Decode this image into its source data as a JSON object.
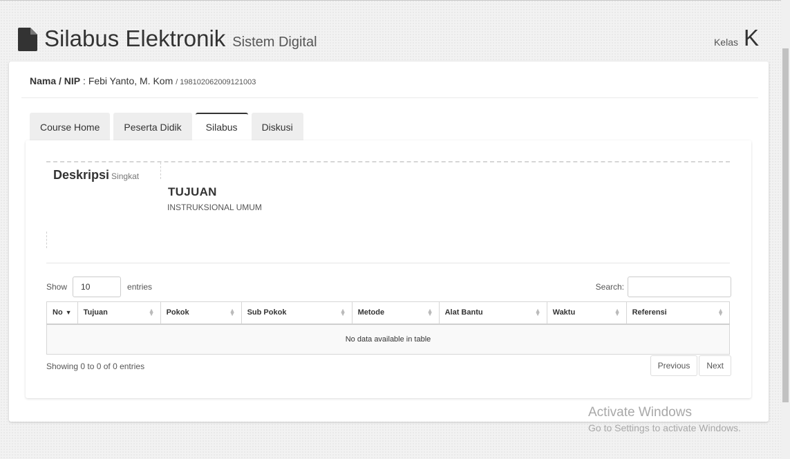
{
  "header": {
    "title": "Silabus Elektronik",
    "subtitle": "Sistem Digital",
    "kelas_label": "Kelas",
    "kelas_value": "K"
  },
  "teacher": {
    "label": "Nama / NIP",
    "name": "Febi Yanto, M. Kom",
    "nip": "198102062009121003"
  },
  "tabs": [
    {
      "label": "Course Home",
      "active": false
    },
    {
      "label": "Peserta Didik",
      "active": false
    },
    {
      "label": "Silabus",
      "active": true
    },
    {
      "label": "Diskusi",
      "active": false
    }
  ],
  "deskripsi": {
    "title": "Deskripsi",
    "subtitle": "Singkat"
  },
  "tujuan": {
    "title": "TUJUAN",
    "subtitle": "INSTRUKSIONAL UMUM"
  },
  "table_controls": {
    "show_label": "Show",
    "length_value": "10",
    "entries_label": "entries",
    "search_label": "Search:",
    "search_value": ""
  },
  "table": {
    "columns": [
      "No",
      "Tujuan",
      "Pokok",
      "Sub Pokok",
      "Metode",
      "Alat Bantu",
      "Waktu",
      "Referensi"
    ],
    "empty_message": "No data available in table",
    "info": "Showing 0 to 0 of 0 entries"
  },
  "pagination": {
    "previous": "Previous",
    "next": "Next"
  },
  "watermark": {
    "line1": "Activate Windows",
    "line2": "Go to Settings to activate Windows."
  },
  "icons": {
    "header": "document-icon",
    "sort": "sort-icon",
    "sort_desc": "sort-desc-icon"
  }
}
